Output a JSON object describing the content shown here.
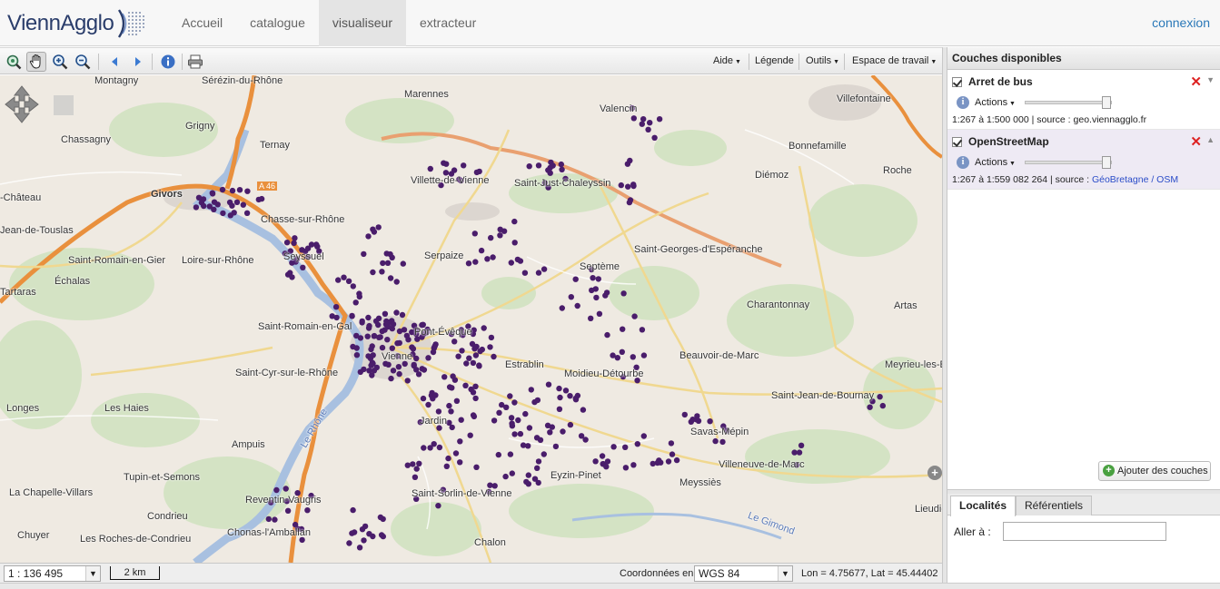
{
  "header": {
    "logo_text": "ViennAgglo",
    "nav": [
      "Accueil",
      "catalogue",
      "visualiseur",
      "extracteur"
    ],
    "active_nav": "visualiseur",
    "login": "connexion"
  },
  "toolbar": {
    "tools": [
      "zoom-extent-icon",
      "pan-hand-icon",
      "zoom-in-icon",
      "zoom-out-icon",
      "history-back-icon",
      "history-forward-icon",
      "info-icon",
      "print-icon"
    ],
    "menus": [
      "Aide",
      "Légende",
      "Outils",
      "Espace de travail"
    ]
  },
  "map": {
    "places": [
      "Montagny",
      "Sérézin-du-Rhône",
      "Marennes",
      "Villefontaine",
      "Chassagny",
      "Grigny",
      "Ternay",
      "Valencin",
      "Bonnefamille",
      "Givors",
      "A 46",
      "Villette-de-Vienne",
      "Saint-Just-Chaleyssin",
      "Diémoz",
      "Roche",
      "-Château",
      "Chasse-sur-Rhône",
      "Jean-de-Touslas",
      "Saint-Georges-d'Espéranche",
      "Saint-Romain-en-Gier",
      "Loire-sur-Rhône",
      "Seyssuel",
      "Serpaize",
      "Septème",
      "Échalas",
      "Tartaras",
      "Charantonnay",
      "Artas",
      "Saint-Romain-en-Gal",
      "Pont-Évêque",
      "Vienne",
      "Beauvoir-de-Marc",
      "Estrablin",
      "Saint-Cyr-sur-le-Rhône",
      "Meyrieu-les-Étangs",
      "Saint-Jean-de-Bournay",
      "Longes",
      "Les Haies",
      "Jardin",
      "Savas-Mépin",
      "Ampuis",
      "Le Rhône",
      "Tupin-et-Semons",
      "Villeneuve-de-Marc",
      "Moidieu-Détourbe",
      "Eyzin-Pinet",
      "Meyssiès",
      "La Chapelle-Villars",
      "Saint-Sorlin-de-Vienne",
      "Reventin-Vaugris",
      "Condrieu",
      "Chonas-l'Amballan",
      "Chuyer",
      "Les Roches-de-Condrieu",
      "Chalon",
      "Le Gimond",
      "Lieudieu"
    ]
  },
  "status": {
    "scale": "1 : 136 495",
    "scalebar": "2 km",
    "coords_label": "Coordonnées en",
    "projection": "WGS 84",
    "lonlat": "Lon = 4.75677, Lat = 45.44402"
  },
  "layers": {
    "title": "Couches disponibles",
    "items": [
      {
        "name": "Arret de bus",
        "actions": "Actions",
        "scale_range": "1:267 à 1:500 000",
        "source_label": "source :",
        "source": "geo.viennagglo.fr",
        "source_is_link": false
      },
      {
        "name": "OpenStreetMap",
        "actions": "Actions",
        "scale_range": "1:267 à 1:559 082 264",
        "source_label": "source :",
        "source": "GéoBretagne / OSM",
        "source_is_link": true
      }
    ],
    "add_button": "Ajouter des couches"
  },
  "localites": {
    "tabs": [
      "Localités",
      "Référentiels"
    ],
    "goto_label": "Aller à :",
    "goto_value": ""
  },
  "colors": {
    "bus_stop": "#4a1d6b",
    "motorway": "#f0a050",
    "river": "#9cb6d8",
    "link": "#2a78b8"
  }
}
